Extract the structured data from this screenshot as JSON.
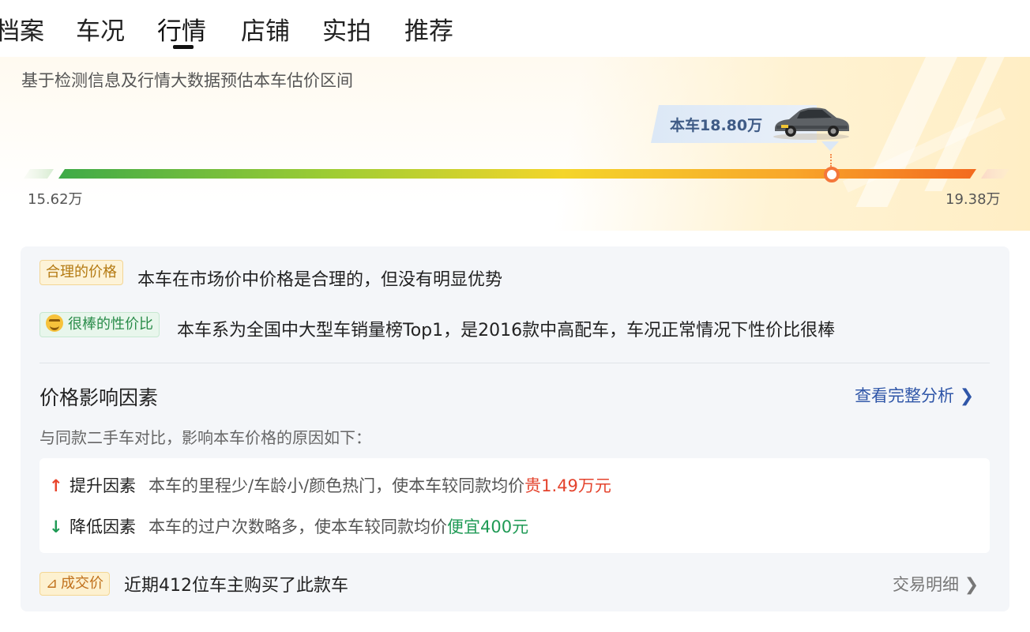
{
  "tabs": [
    {
      "label": "档案"
    },
    {
      "label": "车况"
    },
    {
      "label": "行情",
      "active": true
    },
    {
      "label": "店铺"
    },
    {
      "label": "实拍"
    },
    {
      "label": "推荐"
    }
  ],
  "estimate": {
    "subtitle": "基于检测信息及行情大数据预估本车估价区间",
    "this_car_label": "本车18.80万",
    "range_min": "15.62万",
    "range_max": "19.38万",
    "this_car_value_wan": 18.8,
    "range_min_wan": 15.62,
    "range_max_wan": 19.38
  },
  "verdicts": [
    {
      "badge": "合理的价格",
      "text": "本车在市场价中价格是合理的，但没有明显优势"
    },
    {
      "badge": "很棒的性价比",
      "text": "本车系为全国中大型车销量榜Top1，是2016款中高配车，车况正常情况下性价比很棒"
    }
  ],
  "factors_section": {
    "title": "价格影响因素",
    "link": "查看完整分析",
    "desc": "与同款二手车对比，影响本车价格的原因如下：",
    "up": {
      "arrow": "↑",
      "label": "提升因素",
      "desc": "本车的里程少/车龄小/颜色热门，使本车较同款均价",
      "value": "贵1.49万元"
    },
    "down": {
      "arrow": "↓",
      "label": "降低因素",
      "desc": "本车的过户次数略多，使本车较同款均价",
      "value": "便宜400元"
    }
  },
  "deals": {
    "badge": "成交价",
    "text": "近期412位车主购买了此款车",
    "link": "交易明细"
  },
  "colors": {
    "accent_blue": "#2f56a8",
    "up_red": "#e4432d",
    "down_green": "#1f9a55",
    "marker_orange": "#f4773b"
  }
}
